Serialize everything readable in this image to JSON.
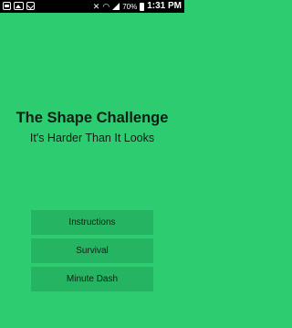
{
  "status_bar": {
    "icons_left": [
      "messenger-icon",
      "image-icon",
      "mail-icon"
    ],
    "icons_right": [
      "mute-icon",
      "wifi-icon",
      "signal-icon",
      "battery-icon"
    ],
    "battery_percent": "70%",
    "time": "1:31 PM"
  },
  "app": {
    "title": "The Shape Challenge",
    "subtitle": "It's Harder Than It Looks"
  },
  "menu": {
    "instructions_label": "Instructions",
    "survival_label": "Survival",
    "minute_dash_label": "Minute Dash"
  },
  "colors": {
    "background": "#2ecc71",
    "button": "#25b461",
    "text": "#0d1f14",
    "status_bar": "#000000"
  }
}
